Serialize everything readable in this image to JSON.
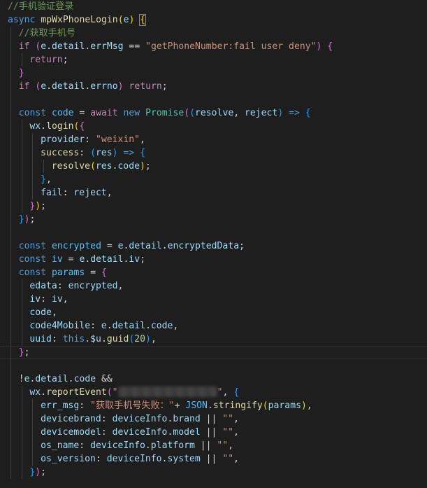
{
  "editor": {
    "theme_background": "#1e1e1e",
    "lines": [
      {
        "indent": 0,
        "tokens": [
          [
            "comment",
            "//手机验证登录"
          ]
        ]
      },
      {
        "indent": 0,
        "tokens": [
          [
            "kw",
            "async"
          ],
          [
            "op",
            " "
          ],
          [
            "fn",
            "mpWxPhoneLogin"
          ],
          [
            "b1",
            "("
          ],
          [
            "var",
            "e"
          ],
          [
            "b1",
            ")"
          ],
          [
            "op",
            " "
          ],
          [
            "b1box",
            "{"
          ]
        ]
      },
      {
        "indent": 1,
        "tokens": [
          [
            "comment",
            "//获取手机号"
          ]
        ]
      },
      {
        "indent": 1,
        "tokens": [
          [
            "ctrl",
            "if"
          ],
          [
            "op",
            " "
          ],
          [
            "b2",
            "("
          ],
          [
            "var",
            "e"
          ],
          [
            "op",
            "."
          ],
          [
            "var",
            "detail"
          ],
          [
            "op",
            "."
          ],
          [
            "var",
            "errMsg"
          ],
          [
            "op",
            " == "
          ],
          [
            "str",
            "\"getPhoneNumber:fail user deny\""
          ],
          [
            "b2",
            ")"
          ],
          [
            "op",
            " "
          ],
          [
            "b2",
            "{"
          ]
        ]
      },
      {
        "indent": 2,
        "tokens": [
          [
            "ctrl",
            "return"
          ],
          [
            "op",
            ";"
          ]
        ]
      },
      {
        "indent": 1,
        "tokens": [
          [
            "b2",
            "}"
          ]
        ]
      },
      {
        "indent": 1,
        "tokens": [
          [
            "ctrl",
            "if"
          ],
          [
            "op",
            " "
          ],
          [
            "b2",
            "("
          ],
          [
            "var",
            "e"
          ],
          [
            "op",
            "."
          ],
          [
            "var",
            "detail"
          ],
          [
            "op",
            "."
          ],
          [
            "var",
            "errno"
          ],
          [
            "b2",
            ")"
          ],
          [
            "op",
            " "
          ],
          [
            "ctrl",
            "return"
          ],
          [
            "op",
            ";"
          ]
        ]
      },
      {
        "indent": 1,
        "tokens": []
      },
      {
        "indent": 1,
        "tokens": [
          [
            "kw",
            "const"
          ],
          [
            "op",
            " "
          ],
          [
            "const",
            "code"
          ],
          [
            "op",
            " = "
          ],
          [
            "ctrl",
            "await"
          ],
          [
            "op",
            " "
          ],
          [
            "kw",
            "new"
          ],
          [
            "op",
            " "
          ],
          [
            "class",
            "Promise"
          ],
          [
            "b2",
            "("
          ],
          [
            "b3",
            "("
          ],
          [
            "var",
            "resolve"
          ],
          [
            "op",
            ", "
          ],
          [
            "var",
            "reject"
          ],
          [
            "b3",
            ")"
          ],
          [
            "op",
            " "
          ],
          [
            "kw",
            "=>"
          ],
          [
            "op",
            " "
          ],
          [
            "b3",
            "{"
          ]
        ]
      },
      {
        "indent": 2,
        "tokens": [
          [
            "var",
            "wx"
          ],
          [
            "op",
            "."
          ],
          [
            "fn",
            "login"
          ],
          [
            "b1",
            "("
          ],
          [
            "b2",
            "{"
          ]
        ]
      },
      {
        "indent": 3,
        "tokens": [
          [
            "var",
            "provider"
          ],
          [
            "op",
            ": "
          ],
          [
            "str",
            "\"weixin\""
          ],
          [
            "op",
            ","
          ]
        ]
      },
      {
        "indent": 3,
        "tokens": [
          [
            "fn",
            "success"
          ],
          [
            "op",
            ": "
          ],
          [
            "b3",
            "("
          ],
          [
            "var",
            "res"
          ],
          [
            "b3",
            ")"
          ],
          [
            "op",
            " "
          ],
          [
            "kw",
            "=>"
          ],
          [
            "op",
            " "
          ],
          [
            "b3",
            "{"
          ]
        ]
      },
      {
        "indent": 4,
        "tokens": [
          [
            "fn",
            "resolve"
          ],
          [
            "b1",
            "("
          ],
          [
            "var",
            "res"
          ],
          [
            "op",
            "."
          ],
          [
            "var",
            "code"
          ],
          [
            "b1",
            ")"
          ],
          [
            "op",
            ";"
          ]
        ]
      },
      {
        "indent": 3,
        "tokens": [
          [
            "b3",
            "}"
          ],
          [
            "op",
            ","
          ]
        ]
      },
      {
        "indent": 3,
        "tokens": [
          [
            "var",
            "fail"
          ],
          [
            "op",
            ": "
          ],
          [
            "var",
            "reject"
          ],
          [
            "op",
            ","
          ]
        ]
      },
      {
        "indent": 2,
        "tokens": [
          [
            "b2",
            "}"
          ],
          [
            "b1",
            ")"
          ],
          [
            "op",
            ";"
          ]
        ]
      },
      {
        "indent": 1,
        "tokens": [
          [
            "b3",
            "}"
          ],
          [
            "b2",
            ")"
          ],
          [
            "op",
            ";"
          ]
        ]
      },
      {
        "indent": 1,
        "tokens": []
      },
      {
        "indent": 1,
        "tokens": [
          [
            "kw",
            "const"
          ],
          [
            "op",
            " "
          ],
          [
            "const",
            "encrypted"
          ],
          [
            "op",
            " = "
          ],
          [
            "var",
            "e"
          ],
          [
            "op",
            "."
          ],
          [
            "var",
            "detail"
          ],
          [
            "op",
            "."
          ],
          [
            "var",
            "encryptedData"
          ],
          [
            "op",
            ";"
          ]
        ]
      },
      {
        "indent": 1,
        "tokens": [
          [
            "kw",
            "const"
          ],
          [
            "op",
            " "
          ],
          [
            "const",
            "iv"
          ],
          [
            "op",
            " = "
          ],
          [
            "var",
            "e"
          ],
          [
            "op",
            "."
          ],
          [
            "var",
            "detail"
          ],
          [
            "op",
            "."
          ],
          [
            "var",
            "iv"
          ],
          [
            "op",
            ";"
          ]
        ]
      },
      {
        "indent": 1,
        "tokens": [
          [
            "kw",
            "const"
          ],
          [
            "op",
            " "
          ],
          [
            "const",
            "params"
          ],
          [
            "op",
            " = "
          ],
          [
            "b2",
            "{"
          ]
        ]
      },
      {
        "indent": 2,
        "tokens": [
          [
            "var",
            "edata"
          ],
          [
            "op",
            ": "
          ],
          [
            "var",
            "encrypted"
          ],
          [
            "op",
            ","
          ]
        ]
      },
      {
        "indent": 2,
        "tokens": [
          [
            "var",
            "iv"
          ],
          [
            "op",
            ": "
          ],
          [
            "var",
            "iv"
          ],
          [
            "op",
            ","
          ]
        ]
      },
      {
        "indent": 2,
        "tokens": [
          [
            "var",
            "code"
          ],
          [
            "op",
            ","
          ]
        ]
      },
      {
        "indent": 2,
        "tokens": [
          [
            "var",
            "code4Mobile"
          ],
          [
            "op",
            ": "
          ],
          [
            "var",
            "e"
          ],
          [
            "op",
            "."
          ],
          [
            "var",
            "detail"
          ],
          [
            "op",
            "."
          ],
          [
            "var",
            "code"
          ],
          [
            "op",
            ","
          ]
        ]
      },
      {
        "indent": 2,
        "tokens": [
          [
            "var",
            "uuid"
          ],
          [
            "op",
            ": "
          ],
          [
            "kw",
            "this"
          ],
          [
            "op",
            "."
          ],
          [
            "var",
            "$u"
          ],
          [
            "op",
            "."
          ],
          [
            "fn",
            "guid"
          ],
          [
            "b3",
            "("
          ],
          [
            "num",
            "20"
          ],
          [
            "b3",
            ")"
          ],
          [
            "op",
            ","
          ]
        ]
      },
      {
        "indent": 1,
        "highlight": true,
        "tokens": [
          [
            "b2",
            "}"
          ],
          [
            "op",
            ";"
          ]
        ]
      },
      {
        "indent": 1,
        "tokens": []
      },
      {
        "indent": 1,
        "tokens": [
          [
            "op",
            "!"
          ],
          [
            "var",
            "e"
          ],
          [
            "op",
            "."
          ],
          [
            "var",
            "detail"
          ],
          [
            "op",
            "."
          ],
          [
            "var",
            "code"
          ],
          [
            "op",
            " &&"
          ]
        ]
      },
      {
        "indent": 2,
        "tokens": [
          [
            "var",
            "wx"
          ],
          [
            "op",
            "."
          ],
          [
            "fn",
            "reportEvent"
          ],
          [
            "b2",
            "("
          ],
          [
            "str",
            "\""
          ],
          [
            "redacted",
            ""
          ],
          [
            "str",
            "\""
          ],
          [
            "op",
            ", "
          ],
          [
            "b3",
            "{"
          ]
        ]
      },
      {
        "indent": 3,
        "tokens": [
          [
            "var",
            "err_msg"
          ],
          [
            "op",
            ": "
          ],
          [
            "str",
            "\"获取手机号失败：\""
          ],
          [
            "op",
            "+ "
          ],
          [
            "const",
            "JSON"
          ],
          [
            "op",
            "."
          ],
          [
            "fn",
            "stringify"
          ],
          [
            "b1",
            "("
          ],
          [
            "var",
            "params"
          ],
          [
            "b1",
            ")"
          ],
          [
            "op",
            ","
          ]
        ]
      },
      {
        "indent": 3,
        "tokens": [
          [
            "var",
            "devicebrand"
          ],
          [
            "op",
            ": "
          ],
          [
            "var",
            "deviceInfo"
          ],
          [
            "op",
            "."
          ],
          [
            "var",
            "brand"
          ],
          [
            "op",
            " || "
          ],
          [
            "str",
            "\"\""
          ],
          [
            "op",
            ","
          ]
        ]
      },
      {
        "indent": 3,
        "tokens": [
          [
            "var",
            "devicemodel"
          ],
          [
            "op",
            ": "
          ],
          [
            "var",
            "deviceInfo"
          ],
          [
            "op",
            "."
          ],
          [
            "var",
            "model"
          ],
          [
            "op",
            " || "
          ],
          [
            "str",
            "\"\""
          ],
          [
            "op",
            ","
          ]
        ]
      },
      {
        "indent": 3,
        "tokens": [
          [
            "var",
            "os_name"
          ],
          [
            "op",
            ": "
          ],
          [
            "var",
            "deviceInfo"
          ],
          [
            "op",
            "."
          ],
          [
            "var",
            "platform"
          ],
          [
            "op",
            " || "
          ],
          [
            "str",
            "\"\""
          ],
          [
            "op",
            ","
          ]
        ]
      },
      {
        "indent": 3,
        "tokens": [
          [
            "var",
            "os_version"
          ],
          [
            "op",
            ": "
          ],
          [
            "var",
            "deviceInfo"
          ],
          [
            "op",
            "."
          ],
          [
            "var",
            "system"
          ],
          [
            "op",
            " || "
          ],
          [
            "str",
            "\"\""
          ],
          [
            "op",
            ","
          ]
        ]
      },
      {
        "indent": 2,
        "tokens": [
          [
            "b3",
            "}"
          ],
          [
            "b2",
            ")"
          ],
          [
            "op",
            ";"
          ]
        ]
      }
    ]
  }
}
